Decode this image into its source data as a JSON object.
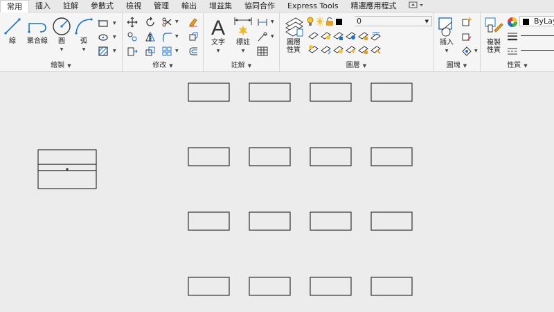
{
  "tabs": [
    {
      "label": "常用",
      "active": true
    },
    {
      "label": "插入"
    },
    {
      "label": "註解"
    },
    {
      "label": "參數式"
    },
    {
      "label": "檢視"
    },
    {
      "label": "管理"
    },
    {
      "label": "輸出"
    },
    {
      "label": "增益集"
    },
    {
      "label": "協同合作"
    },
    {
      "label": "Express Tools"
    },
    {
      "label": "精選應用程式"
    }
  ],
  "ribbon": {
    "draw": {
      "title": "繪製",
      "line": "線",
      "polyline": "聚合線",
      "circle": "圓",
      "arc": "弧"
    },
    "modify": {
      "title": "修改"
    },
    "annotation": {
      "title": "註解",
      "text": "文字",
      "dimension": "標註"
    },
    "layers": {
      "title": "圖層",
      "properties_line1": "圖層",
      "properties_line2": "性質",
      "current_layer": "0"
    },
    "block": {
      "title": "圖塊",
      "insert": "插入"
    },
    "properties": {
      "title": "性質",
      "match_line1": "複製",
      "match_line2": "性質",
      "color_value": "ByLay"
    }
  },
  "colors": {
    "accent_blue": "#1a73c9",
    "icon_orange": "#e8a020",
    "canvas_bg": "#ececec"
  },
  "canvas": {
    "rect_grid_rows": 4,
    "rect_grid_cols": 4,
    "stacked_block": "three stacked rectangles with a center point"
  }
}
